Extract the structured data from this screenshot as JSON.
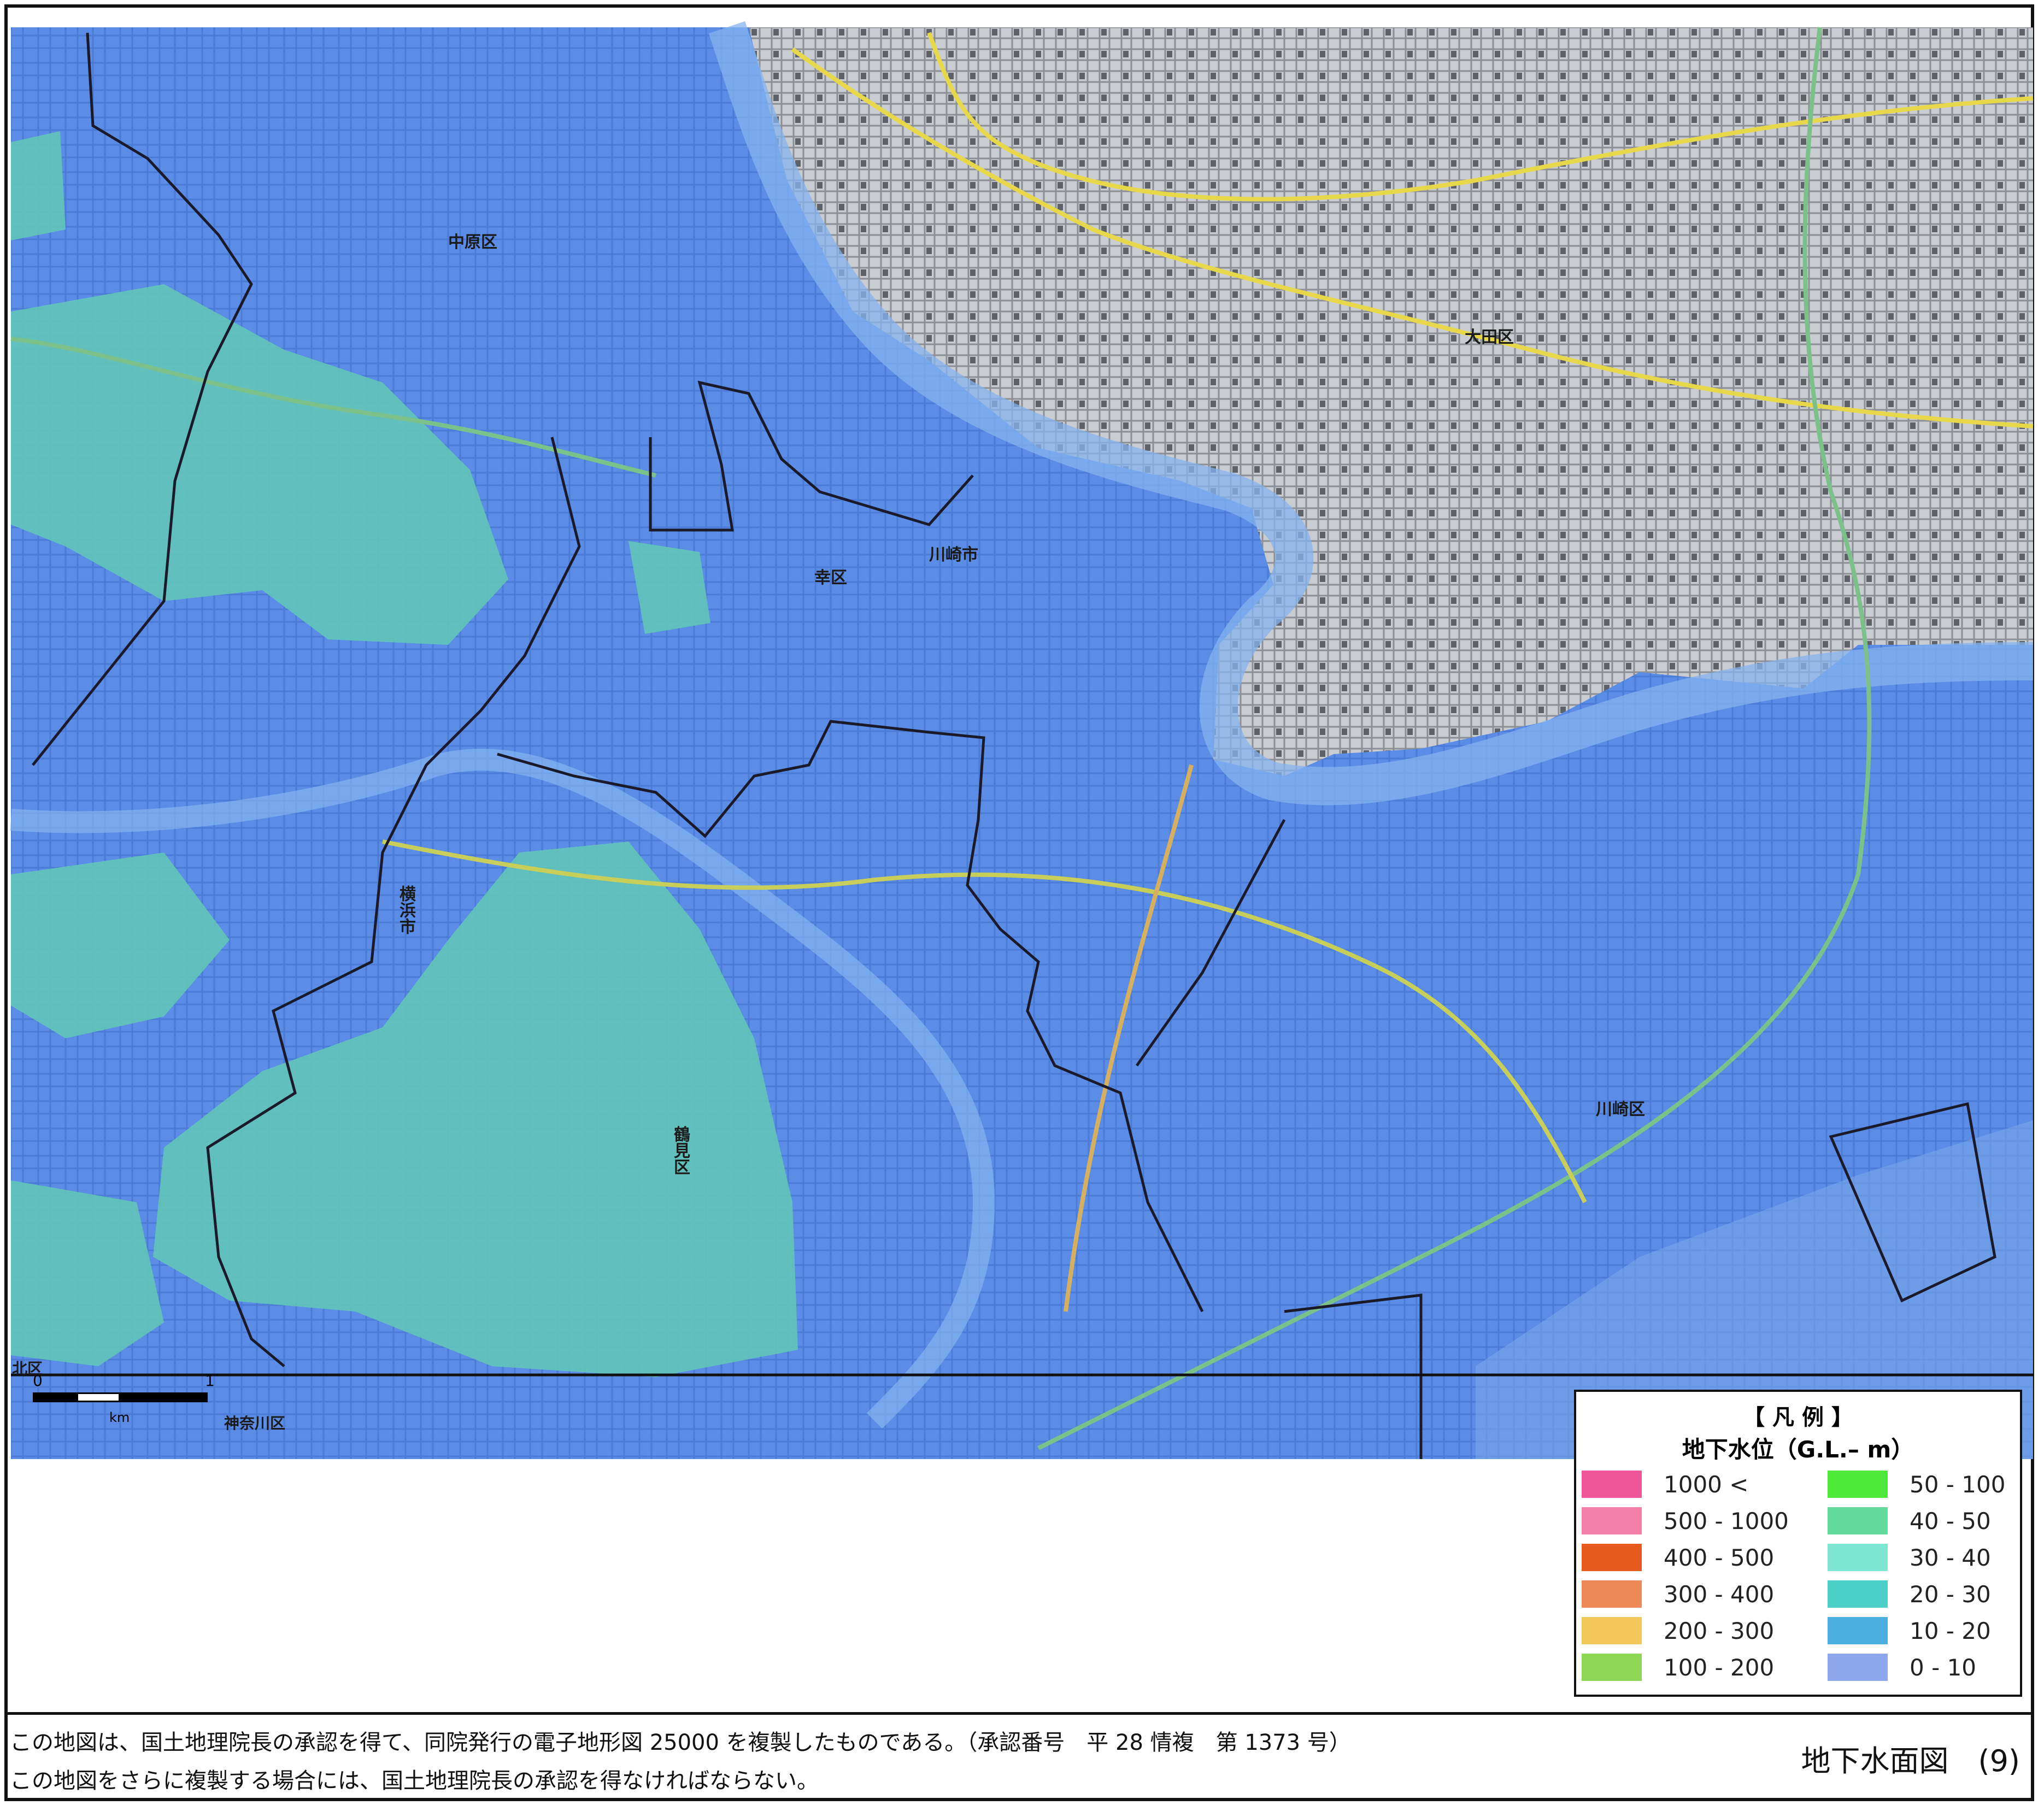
{
  "map": {
    "place_labels": {
      "nakahara": "中原区",
      "saiwai": "幸区",
      "kawasaki_city": "川崎市",
      "ota": "大田区",
      "kawasaki_ward": "川崎区",
      "yokohama_city": "横浜市",
      "tsurumi": "鶴見区",
      "kanagawa": "神奈川区",
      "kita_fragment": "北区"
    },
    "scale": {
      "zero": "0",
      "one": "1",
      "unit": "km"
    }
  },
  "legend": {
    "title": "【 凡 例 】",
    "subtitle": "地下水位（G.L.– m）",
    "items_left": [
      {
        "label": "1000 <",
        "color": "#f0559a"
      },
      {
        "label": "500 - 1000",
        "color": "#f57ea8"
      },
      {
        "label": "400 - 500",
        "color": "#e65a1e"
      },
      {
        "label": "300 - 400",
        "color": "#ee8858"
      },
      {
        "label": "200 - 300",
        "color": "#f3c75a"
      },
      {
        "label": "100 - 200",
        "color": "#8ed655"
      }
    ],
    "items_right": [
      {
        "label": "50 - 100",
        "color": "#4ee83a"
      },
      {
        "label": "40 - 50",
        "color": "#63dc9b"
      },
      {
        "label": "30 - 40",
        "color": "#7de7d4"
      },
      {
        "label": "20 - 30",
        "color": "#4ccfc6"
      },
      {
        "label": "10 - 20",
        "color": "#4aaede"
      },
      {
        "label": "0 - 10",
        "color": "#8ea6ec"
      }
    ]
  },
  "footer": {
    "note1": "この地図は、国土地理院長の承認を得て、同院発行の電子地形図 25000 を複製したものである。（承認番号　平 28 情複　第 1373 号）",
    "note2": "この地図をさらに複製する場合には、国土地理院長の承認を得なければならない。",
    "sheet_title": "地下水面図　(9)"
  }
}
